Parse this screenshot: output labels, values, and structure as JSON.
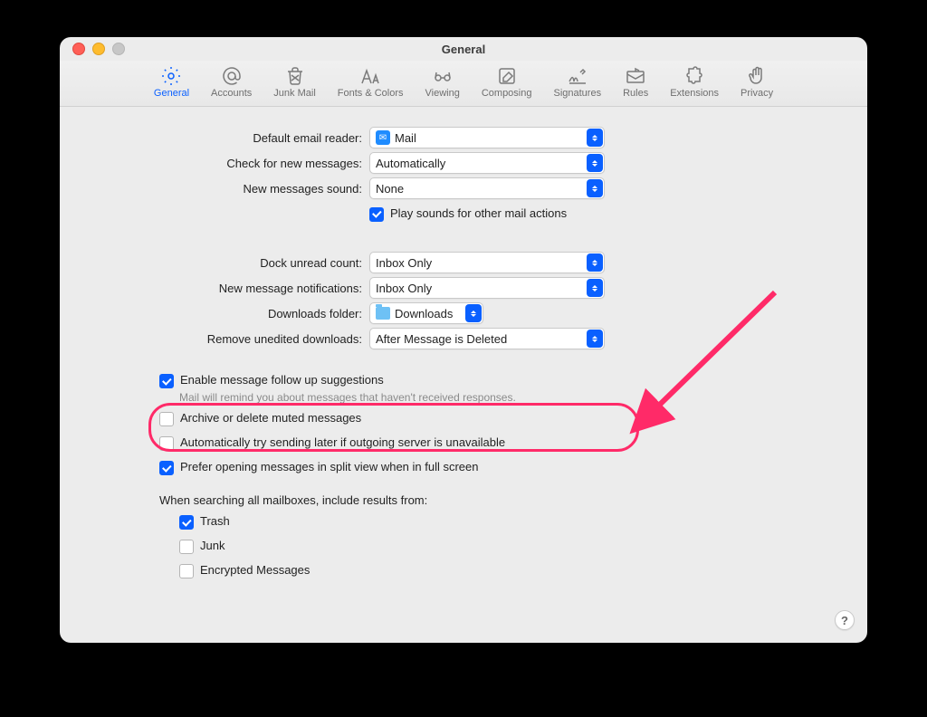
{
  "window": {
    "title": "General"
  },
  "tabs": {
    "general": "General",
    "accounts": "Accounts",
    "junk": "Junk Mail",
    "fonts": "Fonts & Colors",
    "viewing": "Viewing",
    "composing": "Composing",
    "signatures": "Signatures",
    "rules": "Rules",
    "extensions": "Extensions",
    "privacy": "Privacy"
  },
  "labels": {
    "default_reader": "Default email reader:",
    "check_messages": "Check for new messages:",
    "sound": "New messages sound:",
    "play_sounds": "Play sounds for other mail actions",
    "dock_count": "Dock unread count:",
    "notifications": "New message notifications:",
    "downloads": "Downloads folder:",
    "remove_dl": "Remove unedited downloads:",
    "followup": "Enable message follow up suggestions",
    "followup_hint": "Mail will remind you about messages that haven't received responses.",
    "archive_muted": "Archive or delete muted messages",
    "auto_send_later": "Automatically try sending later if outgoing server is unavailable",
    "split_view": "Prefer opening messages in split view when in full screen",
    "search_header": "When searching all mailboxes, include results from:",
    "trash": "Trash",
    "junk_folder": "Junk",
    "encrypted": "Encrypted Messages"
  },
  "values": {
    "default_reader": "Mail",
    "check_messages": "Automatically",
    "sound": "None",
    "dock_count": "Inbox Only",
    "notifications": "Inbox Only",
    "downloads": "Downloads",
    "remove_dl": "After Message is Deleted"
  },
  "help": "?"
}
